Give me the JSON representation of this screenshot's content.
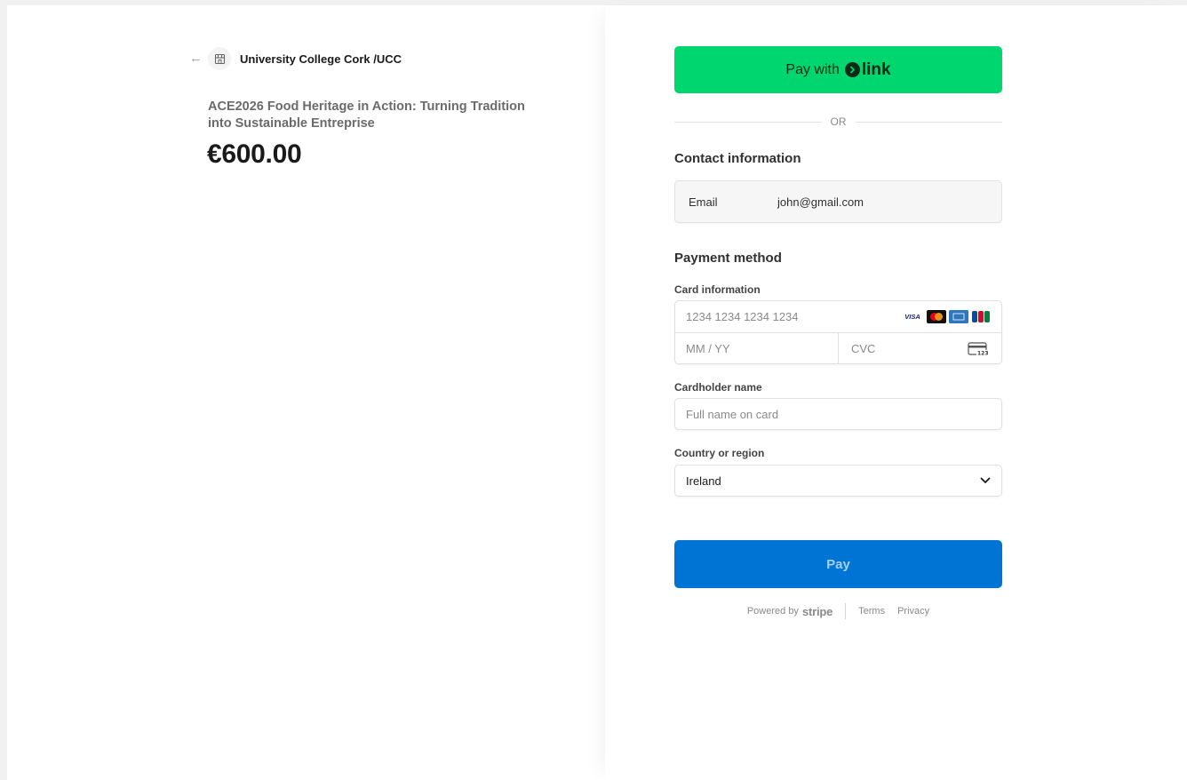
{
  "merchant": {
    "name": "University College Cork /UCC"
  },
  "product": {
    "name": "ACE2026 Food Heritage in Action: Turning Tradition into Sustainable Entreprise",
    "price": "€600.00"
  },
  "link_button": {
    "prefix": "Pay with",
    "brand": "link"
  },
  "divider_text": "OR",
  "contact": {
    "title": "Contact information",
    "email_label": "Email",
    "email_value": "john@gmail.com"
  },
  "payment": {
    "title": "Payment method",
    "card_label": "Card information",
    "card_number_placeholder": "1234 1234 1234 1234",
    "expiry_placeholder": "MM / YY",
    "cvc_placeholder": "CVC",
    "card_brands": [
      "visa",
      "mastercard",
      "amex",
      "jcb"
    ],
    "visa_text": "VISA",
    "cardholder_label": "Cardholder name",
    "cardholder_placeholder": "Full name on card",
    "country_label": "Country or region",
    "country_value": "Ireland"
  },
  "pay_button": {
    "label": "Pay"
  },
  "footer": {
    "powered_by": "Powered by",
    "brand": "stripe",
    "terms": "Terms",
    "privacy": "Privacy"
  },
  "colors": {
    "link_green": "#00d66f",
    "pay_blue": "#0074d4",
    "page_background": "#f1f1f1"
  }
}
